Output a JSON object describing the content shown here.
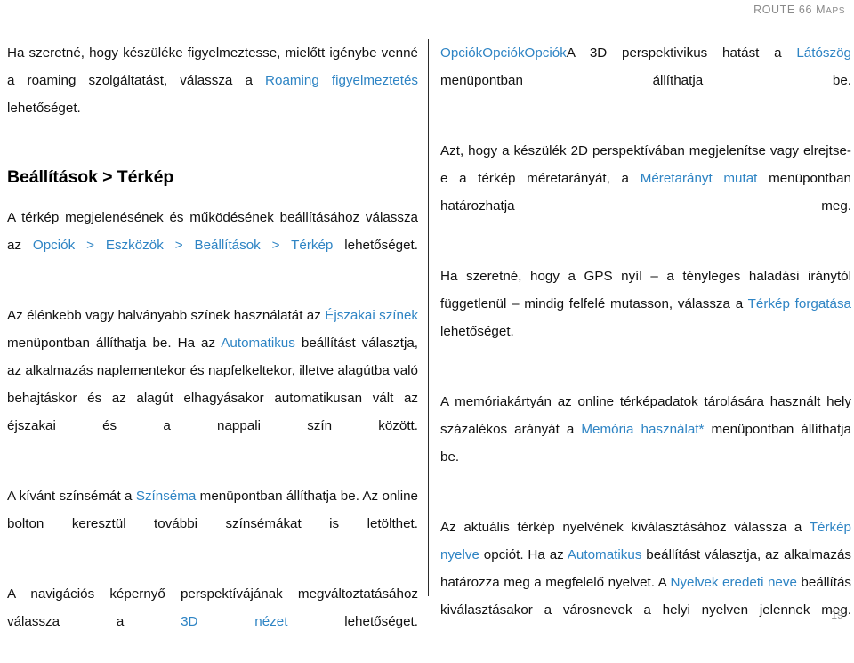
{
  "header": {
    "running_head_main": "ROUTE 66 ",
    "running_head_num": "66 ",
    "running_head_word_1": "ROUTE",
    "running_head_word_2": "66",
    "running_head_word_3": "M",
    "running_head_word_4": "APS"
  },
  "left_column": {
    "paragraph_1": {
      "t1": "Ha szeretné, hogy készüléke figyelmeztesse, mielőtt igénybe venné a roaming szolgáltatást, válassza a ",
      "link1": "Roaming figyelmeztetés",
      "t2": " lehetőséget."
    },
    "heading": "Beállítások > Térkép",
    "paragraph_2": {
      "t1": "A térkép megjelenésének és működésének beállításához válassza az ",
      "link1": "Opciók",
      "sep1": " > ",
      "link2": "Eszközök",
      "sep2": " > ",
      "link3": "Beállítások",
      "sep3": " > ",
      "link4": "Térkép",
      "t2": " lehetőséget."
    },
    "paragraph_3": {
      "t1": "Az élénkebb vagy halványabb színek használatát az ",
      "link1": "Éjszakai színek",
      "t2": " menüpontban állíthatja be. Ha az ",
      "link2": "Automatikus",
      "t3": " beállítást választja, az alkalmazás naplementekor és napfelkeltekor, illetve alagútba való behajtáskor és az alagút elhagyásakor automatikusan vált az éjszakai és a nappali szín között."
    },
    "paragraph_4": {
      "t1": "A kívánt színsémát a ",
      "link1": "Színséma",
      "t2": " menüpontban állíthatja be. Az online bolton keresztül további színsémákat is letölthet."
    },
    "paragraph_5": {
      "t1": "A navigációs képernyő perspektívájának megváltoztatásához válassza a ",
      "link1": "3D nézet",
      "t2": " lehetőséget."
    }
  },
  "right_column": {
    "paragraph_1": {
      "link0": "OpciókOpciókOpciók",
      "t1": "A 3D perspektivikus hatást a ",
      "link1": "Látószög",
      "t2": " menüpontban állíthatja be."
    },
    "paragraph_2": {
      "t1": "Azt, hogy a készülék 2D perspektívában megjelenítse vagy elrejtse-e a térkép méretarányát, a ",
      "link1": "Méretarányt mutat",
      "t2": " menüpontban határozhatja meg."
    },
    "paragraph_3": {
      "t1": "Ha szeretné, hogy a GPS nyíl – a tényleges haladási iránytól függetlenül – mindig felfelé mutasson, válassza a ",
      "link1": "Térkép forgatása",
      "t2": " lehetőséget."
    },
    "paragraph_4": {
      "t1": "A memóriakártyán az online térképadatok tárolására használt hely százalékos arányát a ",
      "link1": "Memória használat*",
      "t2": " menüpontban állíthatja be."
    },
    "paragraph_5": {
      "t1": "Az aktuális térkép nyelvének kiválasztásához válassza a ",
      "link1": "Térkép nyelve",
      "t2": " opciót. Ha az ",
      "link2": "Automatikus",
      "t3": " beállítást választja, az alkalmazás határozza meg a megfelelő nyelvet. A ",
      "link3": "Nyelvek eredeti neve",
      "t4": " beállítás kiválasztásakor a városnevek a helyi nyelven jelennek meg."
    }
  },
  "footer": {
    "page_number": "19"
  },
  "colors": {
    "link": "#2e84c4",
    "body_text": "#111111",
    "running_head": "#8a8a8a",
    "divider": "#2b2b2b",
    "folio": "#9a9a9a"
  }
}
